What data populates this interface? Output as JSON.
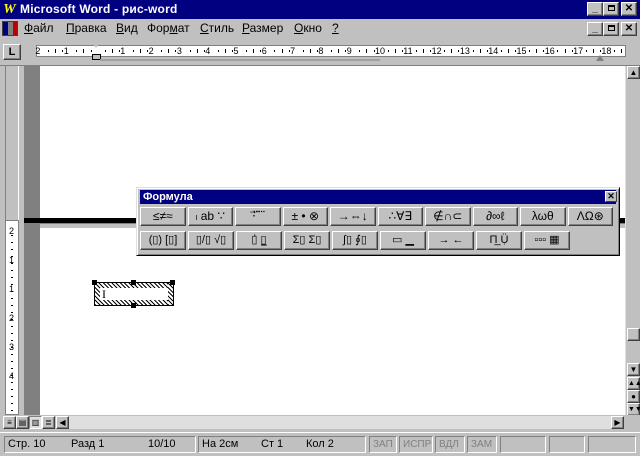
{
  "window": {
    "title": "Microsoft Word - рис-word",
    "app_icon": "word-w-icon"
  },
  "title_controls": {
    "minimize": "_",
    "restore": "🗗",
    "close": "✕"
  },
  "doc_controls": {
    "minimize": "_",
    "restore": "🗗",
    "close": "✕"
  },
  "menu": [
    {
      "label": "Файл"
    },
    {
      "label": "Правка"
    },
    {
      "label": "Вид"
    },
    {
      "label": "Формат"
    },
    {
      "label": "Стиль"
    },
    {
      "label": "Размер"
    },
    {
      "label": "Окно"
    },
    {
      "label": "?"
    }
  ],
  "ruler": {
    "tab_selector": "L",
    "numbers": [
      "2",
      "1",
      "1",
      "2",
      "3",
      "4",
      "5",
      "6",
      "7",
      "8",
      "9",
      "10",
      "11",
      "12",
      "13",
      "14",
      "15",
      "16",
      "17",
      "18"
    ]
  },
  "vruler": {
    "numbers": [
      "2",
      "1",
      "1",
      "2",
      "3",
      "4"
    ]
  },
  "formula_toolbar": {
    "title": "Формула",
    "row1": [
      "≤≠≈",
      "ₗ ab ∵",
      "⋅⃗ ⃛ ⃜",
      "± • ⊗",
      "→⇔↓",
      "∴∀∃",
      "∉∩⊂",
      "∂∞ℓ",
      "λωθ",
      "ΛΩ⊛"
    ],
    "row2": [
      "(▯) [▯]",
      "▯/▯ √▯",
      "▯̇ ▯̲",
      "Σ▯ Σ▯",
      "∫▯ ∮▯",
      "▭ ▁",
      "→ ←",
      "Π̲ Ụ̈",
      "▫▫▫ ▦"
    ]
  },
  "status": {
    "page": "Стр. 10",
    "section": "Разд 1",
    "pages": "10/10",
    "at": "На 2см",
    "line": "Ст 1",
    "col": "Кол 2",
    "rec": "ЗАП",
    "trk": "ИСПР",
    "ext": "ВДЛ",
    "ovr": "ЗАМ"
  },
  "object_marker": "I"
}
